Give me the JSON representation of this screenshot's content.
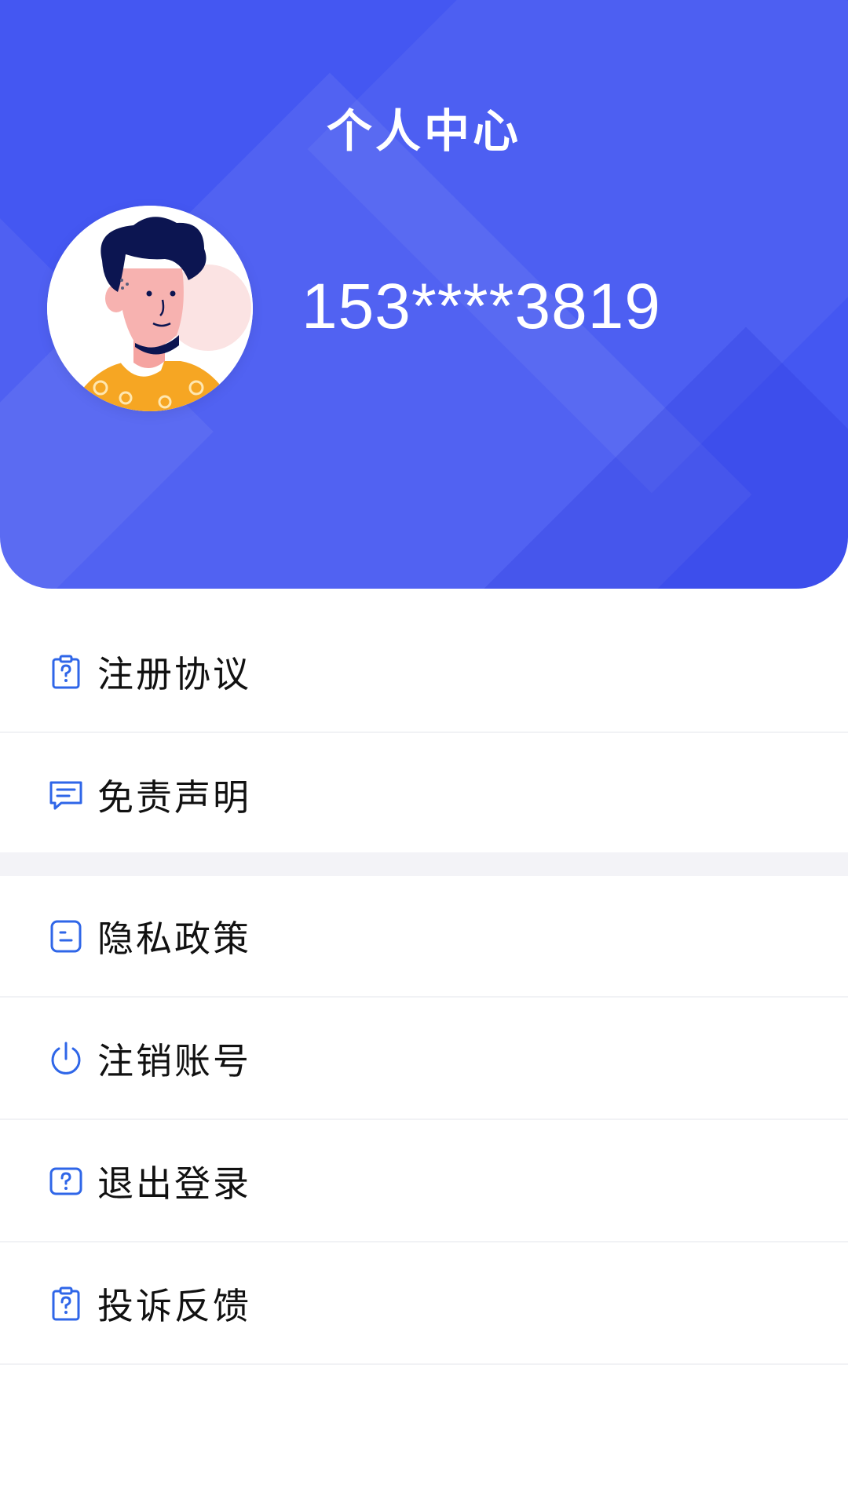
{
  "header": {
    "title": "个人中心",
    "phone": "153****3819"
  },
  "menu": {
    "items": [
      {
        "label": "注册协议",
        "icon": "clipboard-question-icon"
      },
      {
        "label": "免责声明",
        "icon": "message-icon"
      },
      {
        "label": "隐私政策",
        "icon": "document-icon"
      },
      {
        "label": "注销账号",
        "icon": "power-icon"
      },
      {
        "label": "退出登录",
        "icon": "question-box-icon"
      },
      {
        "label": "投诉反馈",
        "icon": "clipboard-question-icon"
      }
    ]
  },
  "colors": {
    "header_bg": "#4457F2",
    "icon_blue": "#2F66E8",
    "divider": "#F1F2F5",
    "section_gap": "#F3F3F7"
  }
}
